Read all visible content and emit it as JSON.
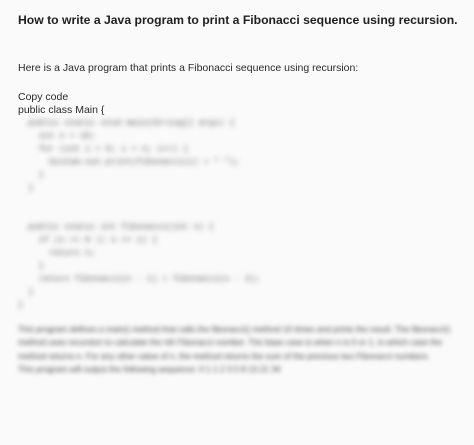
{
  "question": {
    "title": "How to write a Java program to print a Fibonacci sequence using recursion."
  },
  "answer": {
    "intro": "Here is a Java program that prints a Fibonacci sequence using recursion:",
    "copy_label": "Copy code",
    "code_first_line": "public class Main {",
    "code_lines": [
      "  public static void main(String[] args) {",
      "    int n = 10;",
      "    for (int i = 0; i < n; i++) {",
      "      System.out.print(fibonacci(i) + \" \");",
      "    }",
      "  }",
      "",
      "",
      "  public static int fibonacci(int n) {",
      "    if (n == 0 || n == 1) {",
      "      return n;",
      "    }",
      "    return fibonacci(n - 1) + fibonacci(n - 2);",
      "  }",
      "}"
    ],
    "explanation": "This program defines a main() method that calls the fibonacci() method 10 times and prints the result. The fibonacci() method uses recursion to calculate the nth Fibonacci number. The base case is when n is 0 or 1, in which case the method returns n. For any other value of n, the method returns the sum of the previous two Fibonacci numbers.",
    "output_line": "This program will output the following sequence: 0 1 1 2 3 5 8 13 21 34"
  }
}
